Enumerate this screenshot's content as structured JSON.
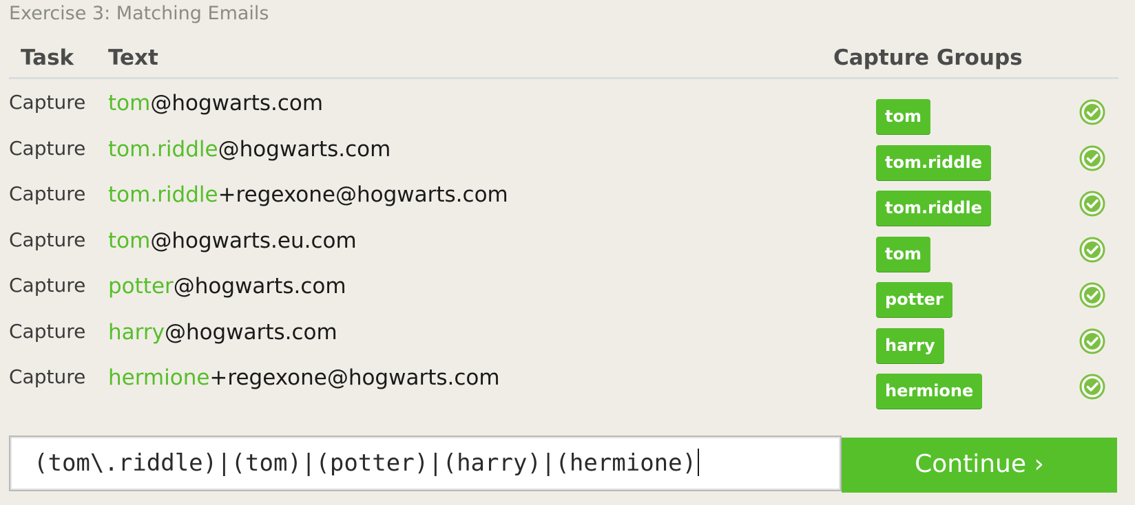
{
  "exercise_title": "Exercise 3: Matching Emails",
  "table": {
    "headers": {
      "task": "Task",
      "text": "Text",
      "capture_groups": "Capture Groups"
    },
    "rows": [
      {
        "task": "Capture",
        "match": "tom",
        "rest": "@hogwarts.com",
        "group": "tom",
        "status": "passed"
      },
      {
        "task": "Capture",
        "match": "tom.riddle",
        "rest": "@hogwarts.com",
        "group": "tom.riddle",
        "status": "passed"
      },
      {
        "task": "Capture",
        "match": "tom.riddle",
        "rest": "+regexone@hogwarts.com",
        "group": "tom.riddle",
        "status": "passed"
      },
      {
        "task": "Capture",
        "match": "tom",
        "rest": "@hogwarts.eu.com",
        "group": "tom",
        "status": "passed"
      },
      {
        "task": "Capture",
        "match": "potter",
        "rest": "@hogwarts.com",
        "group": "potter",
        "status": "passed"
      },
      {
        "task": "Capture",
        "match": "harry",
        "rest": "@hogwarts.com",
        "group": "harry",
        "status": "passed"
      },
      {
        "task": "Capture",
        "match": "hermione",
        "rest": "+regexone@hogwarts.com",
        "group": "hermione",
        "status": "passed"
      }
    ]
  },
  "regex_input": {
    "value": "(tom\\.riddle)|(tom)|(potter)|(harry)|(hermione)"
  },
  "continue_button": {
    "label": "Continue ›"
  },
  "colors": {
    "accent_green": "#56c02b",
    "match_green": "#56be2b",
    "background": "#f0ede6",
    "check_green": "#7bc043"
  },
  "icons": {
    "status": "check-circle-icon"
  }
}
